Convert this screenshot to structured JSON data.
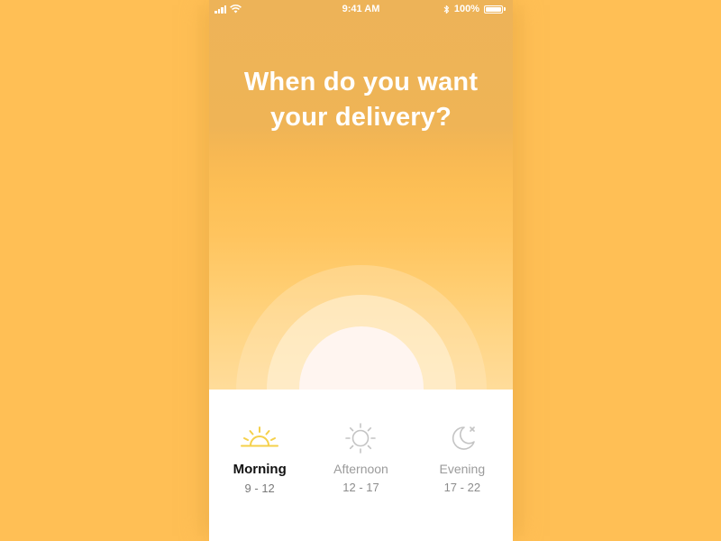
{
  "status_bar": {
    "time": "9:41 AM",
    "battery_label": "100%",
    "icons": [
      "signal-icon",
      "wifi-icon",
      "bluetooth-icon",
      "battery-icon"
    ]
  },
  "header": {
    "title_line1": "When do you want",
    "title_line2": "your delivery?"
  },
  "colors": {
    "page_background": "#FFBF55",
    "accent_yellow": "#F5D04A",
    "inactive_gray": "#9B9B9B",
    "sheet_background": "#FFFFFF"
  },
  "options": [
    {
      "label": "Morning",
      "range": "9 - 12",
      "icon": "sunrise-icon",
      "selected": true
    },
    {
      "label": "Afternoon",
      "range": "12 - 17",
      "icon": "sun-icon",
      "selected": false
    },
    {
      "label": "Evening",
      "range": "17 - 22",
      "icon": "moon-icon",
      "selected": false
    }
  ]
}
